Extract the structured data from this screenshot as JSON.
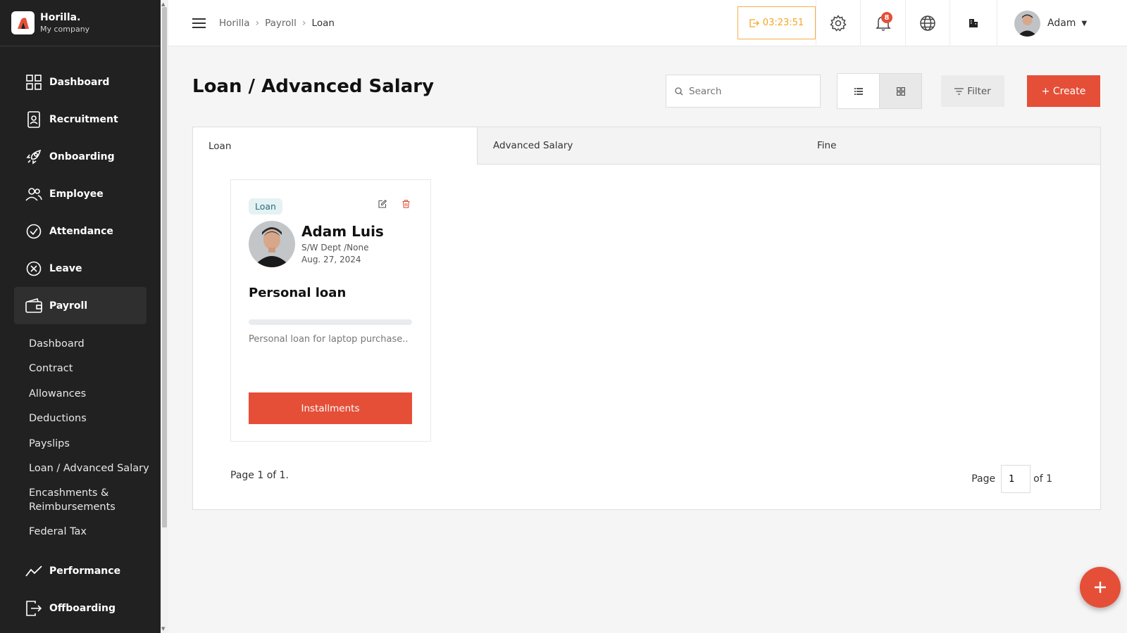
{
  "brand": {
    "name": "Horilla.",
    "company": "My company"
  },
  "sidebar": {
    "items": [
      {
        "label": "Dashboard",
        "icon": "dashboard-icon"
      },
      {
        "label": "Recruitment",
        "icon": "recruitment-icon"
      },
      {
        "label": "Onboarding",
        "icon": "rocket-icon"
      },
      {
        "label": "Employee",
        "icon": "users-icon"
      },
      {
        "label": "Attendance",
        "icon": "check-circle-icon"
      },
      {
        "label": "Leave",
        "icon": "x-circle-icon"
      },
      {
        "label": "Payroll",
        "icon": "wallet-icon"
      },
      {
        "label": "Performance",
        "icon": "trend-icon"
      },
      {
        "label": "Offboarding",
        "icon": "exit-icon"
      }
    ],
    "payroll_sub": [
      "Dashboard",
      "Contract",
      "Allowances",
      "Deductions",
      "Payslips",
      "Loan / Advanced Salary",
      "Encashments & Reimbursements",
      "Federal Tax"
    ]
  },
  "topbar": {
    "breadcrumb": [
      "Horilla",
      "Payroll",
      "Loan"
    ],
    "timer": "03:23:51",
    "notification_count": "8",
    "user_name": "Adam"
  },
  "main": {
    "title": "Loan / Advanced Salary",
    "search_placeholder": "Search",
    "filter_label": "Filter",
    "create_label": "+ Create",
    "tabs": [
      "Loan",
      "Advanced Salary",
      "Fine"
    ]
  },
  "card": {
    "tag": "Loan",
    "name": "Adam Luis",
    "dept": "S/W Dept /None",
    "date": "Aug. 27, 2024",
    "title": "Personal loan",
    "progress": 0,
    "description": "Personal loan for laptop purchase..",
    "button": "Installments"
  },
  "pagination": {
    "info": "Page 1 of 1.",
    "page_label": "Page",
    "page_value": "1",
    "of_label": "of 1"
  },
  "colors": {
    "accent": "#e54f38",
    "sidebar": "#212121",
    "timer": "#f5a623"
  }
}
